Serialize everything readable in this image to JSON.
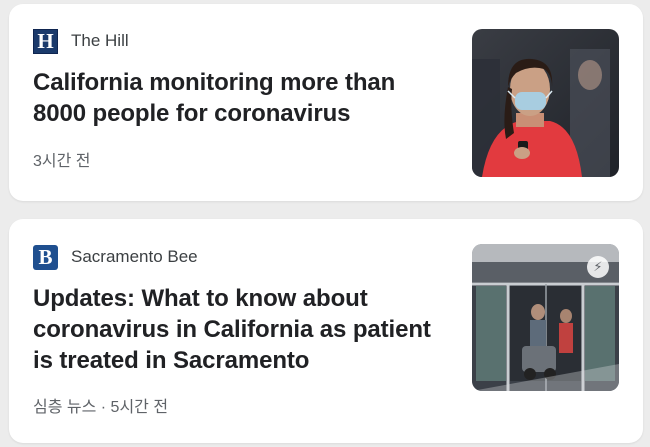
{
  "cards": [
    {
      "source": {
        "logo_letter": "H",
        "name": "The Hill"
      },
      "headline": "California monitoring more than 8000 people for coronavirus",
      "meta": "3시간 전",
      "thumbnail_icon": "woman-mask-phone-photo"
    },
    {
      "source": {
        "logo_letter": "B",
        "name": "Sacramento Bee"
      },
      "headline": "Updates: What to know about coronavirus in California as patient is treated in Sacramento",
      "meta": "심층 뉴스 · 5시간 전",
      "thumbnail_icon": "hospital-entrance-photo",
      "amp_icon": "amp-lightning-icon"
    }
  ],
  "colors": {
    "background": "#ececec",
    "card": "#ffffff",
    "headline": "#202124",
    "meta": "#5f6368",
    "hill_logo": "#1b3a6b",
    "bee_logo": "#1f4f8f"
  }
}
